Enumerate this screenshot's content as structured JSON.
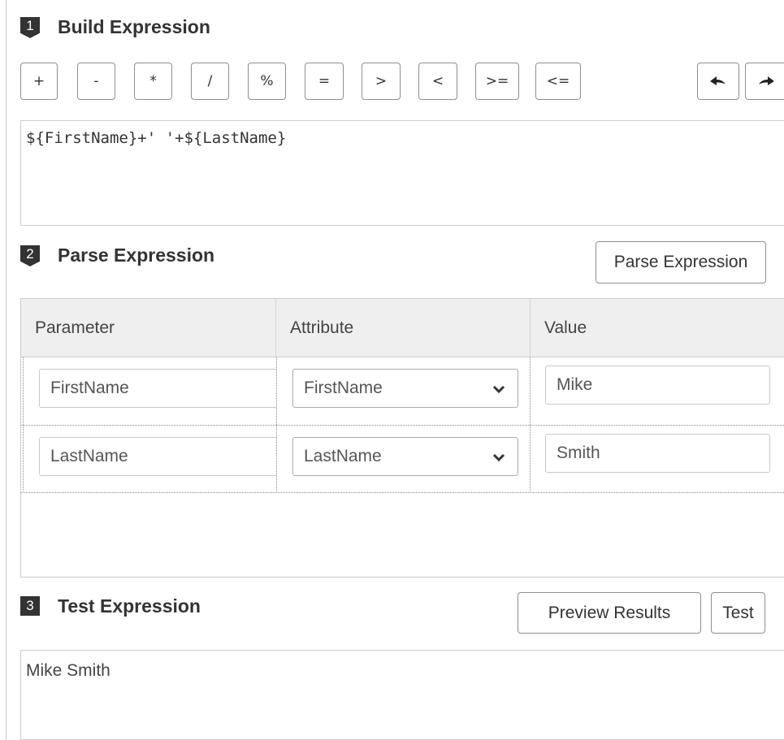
{
  "sections": {
    "build": {
      "number": "1",
      "title": "Build Expression"
    },
    "parse": {
      "number": "2",
      "title": "Parse Expression"
    },
    "test": {
      "number": "3",
      "title": "Test Expression"
    }
  },
  "operators": [
    "+",
    "-",
    "*",
    "/",
    "%",
    "=",
    ">",
    "<",
    ">=",
    "<="
  ],
  "toolbar": {
    "undo_icon": "undo-icon",
    "redo_icon": "redo-icon"
  },
  "expression": {
    "value": "${FirstName}+' '+${LastName}"
  },
  "parse_button": {
    "label": "Parse Expression"
  },
  "grid": {
    "columns": [
      "Parameter",
      "Attribute",
      "Value"
    ],
    "rows": [
      {
        "parameter": "FirstName",
        "attribute": "FirstName",
        "value": "Mike"
      },
      {
        "parameter": "LastName",
        "attribute": "LastName",
        "value": "Smith"
      }
    ]
  },
  "test_buttons": {
    "preview": "Preview Results",
    "test": "Test"
  },
  "result": {
    "value": "Mike Smith"
  },
  "colors": {
    "badge": "#333333",
    "header_bg": "#efefef",
    "border": "#cccccc"
  }
}
